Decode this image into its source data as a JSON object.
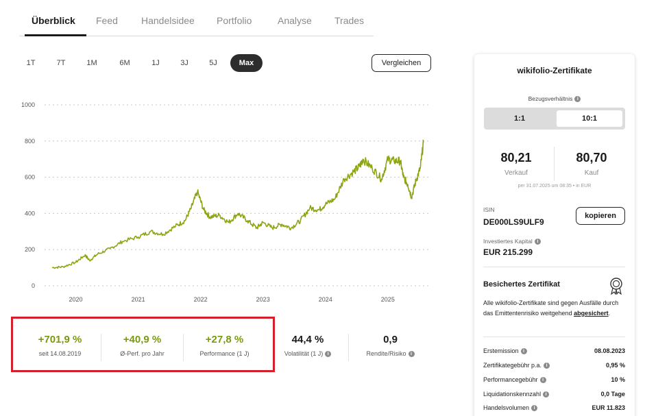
{
  "tabs": [
    "Überblick",
    "Feed",
    "Handelsidee",
    "Portfolio",
    "Analyse",
    "Trades"
  ],
  "active_tab": "Überblick",
  "ranges": [
    "1T",
    "7T",
    "1M",
    "6M",
    "1J",
    "3J",
    "5J",
    "Max"
  ],
  "active_range": "Max",
  "compare_label": "Vergleichen",
  "chart_data": {
    "type": "line",
    "x": [
      2019.62,
      2019.8,
      2020.0,
      2020.15,
      2020.22,
      2020.35,
      2020.55,
      2020.75,
      2021.0,
      2021.2,
      2021.4,
      2021.6,
      2021.75,
      2021.85,
      2021.95,
      2022.05,
      2022.15,
      2022.3,
      2022.45,
      2022.6,
      2022.75,
      2022.9,
      2023.0,
      2023.15,
      2023.3,
      2023.45,
      2023.6,
      2023.75,
      2023.9,
      2024.0,
      2024.15,
      2024.3,
      2024.45,
      2024.55,
      2024.6,
      2024.75,
      2024.9,
      2025.0,
      2025.1,
      2025.2,
      2025.25,
      2025.32,
      2025.38,
      2025.45,
      2025.52,
      2025.57
    ],
    "y": [
      100,
      105,
      130,
      170,
      140,
      175,
      205,
      245,
      270,
      300,
      285,
      330,
      360,
      430,
      520,
      420,
      380,
      390,
      350,
      400,
      360,
      320,
      350,
      320,
      340,
      320,
      360,
      430,
      420,
      450,
      480,
      590,
      630,
      660,
      700,
      650,
      590,
      700,
      690,
      690,
      600,
      560,
      490,
      580,
      650,
      790
    ],
    "xlabel": "",
    "ylabel": "",
    "xticks": [
      "2020",
      "2021",
      "2022",
      "2023",
      "2024",
      "2025"
    ],
    "yticks": [
      "0",
      "200",
      "400",
      "600",
      "800",
      "1000"
    ],
    "ylim": [
      0,
      1000
    ],
    "xlim": [
      2019.5,
      2025.65
    ],
    "grid": true,
    "color": "#8ca515"
  },
  "kpis": [
    {
      "value": "+701,9 %",
      "label": "seit 14.08.2019",
      "green": true,
      "info": false
    },
    {
      "value": "+40,9 %",
      "label": "Ø-Perf. pro Jahr",
      "green": true,
      "info": false
    },
    {
      "value": "+27,8 %",
      "label": "Performance (1 J)",
      "green": true,
      "info": false
    },
    {
      "value": "44,4 %",
      "label": "Volatilität (1 J)",
      "green": false,
      "info": true
    },
    {
      "value": "0,9",
      "label": "Rendite/Risiko",
      "green": false,
      "info": true
    }
  ],
  "card": {
    "title": "wikifolio-Zertifikate",
    "ratio_label": "Bezugsverhältnis",
    "ratio_options": [
      "1:1",
      "10:1"
    ],
    "ratio_selected": "10:1",
    "sell_value": "80,21",
    "sell_label": "Verkauf",
    "buy_value": "80,70",
    "buy_label": "Kauf",
    "price_note": "per 31.07.2025 um 08:35  •  in EUR",
    "isin_label": "ISIN",
    "isin": "DE000LS9ULF9",
    "copy_label": "kopieren",
    "capital_label": "Investiertes Kapital",
    "capital_value": "EUR 215.299",
    "secured_title": "Besichertes Zertifikat",
    "secured_text": "Alle wikifolio-Zertifikate sind gegen Ausfälle durch das Emittentenrisiko weitgehend",
    "secured_link": "abgesichert",
    "secured_end": ".",
    "details": [
      {
        "label": "Erstemission",
        "value": "08.08.2023",
        "info": true
      },
      {
        "label": "Zertifikategebühr p.a.",
        "value": "0,95 %",
        "info": true
      },
      {
        "label": "Performancegebühr",
        "value": "10 %",
        "info": true
      },
      {
        "label": "Liquidationskennzahl",
        "value": "0,0 Tage",
        "info": true
      },
      {
        "label": "Handelsvolumen",
        "value": "EUR 11.823",
        "info": true
      }
    ]
  },
  "colors": {
    "accent_green": "#7a9a0b",
    "line_green": "#8ca515",
    "highlight_red": "#d4202a",
    "dark": "#2d2d2d"
  }
}
